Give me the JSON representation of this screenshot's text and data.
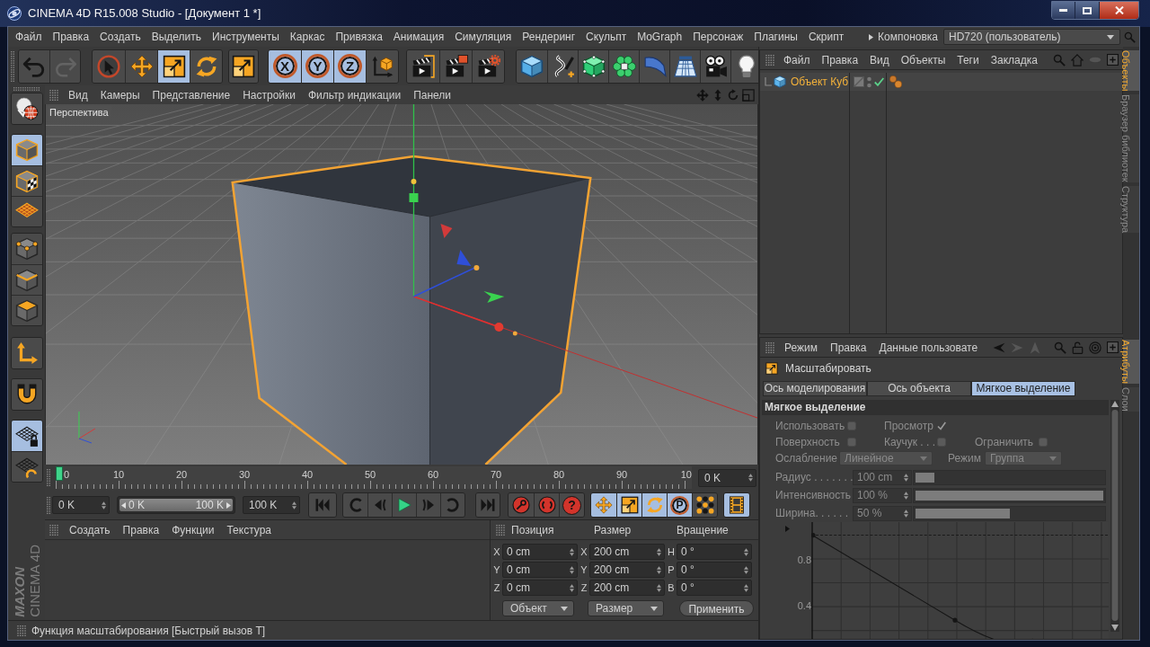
{
  "window": {
    "title": "CINEMA 4D R15.008 Studio - [Документ 1 *]"
  },
  "menu_bar": {
    "items": [
      "Файл",
      "Правка",
      "Создать",
      "Выделить",
      "Инструменты",
      "Каркас",
      "Привязка",
      "Анимация",
      "Симуляция",
      "Рендеринг",
      "Скульпт",
      "MoGraph",
      "Персонаж",
      "Плагины",
      "Скрипт"
    ],
    "layout_label": "Компоновка",
    "layout_value": "HD720 (пользователь)"
  },
  "toolbar": {
    "groups": [
      {
        "items": [
          {
            "kind": "undo",
            "selected": false,
            "disabled": false
          },
          {
            "kind": "redo",
            "selected": false,
            "disabled": true
          }
        ]
      },
      {
        "items": [
          {
            "kind": "select",
            "selected": false,
            "disabled": false
          },
          {
            "kind": "move",
            "selected": false,
            "disabled": false
          },
          {
            "kind": "scale",
            "selected": true,
            "disabled": false
          },
          {
            "kind": "rotate",
            "selected": false,
            "disabled": false
          }
        ]
      },
      {
        "items": [
          {
            "kind": "recent",
            "selected": false,
            "disabled": false
          }
        ]
      },
      {
        "items": [
          {
            "kind": "letter",
            "label": "X",
            "selected": true,
            "disabled": false
          },
          {
            "kind": "letter",
            "label": "Y",
            "selected": true,
            "disabled": false
          },
          {
            "kind": "letter",
            "label": "Z",
            "selected": true,
            "disabled": false
          },
          {
            "kind": "coords",
            "selected": false,
            "disabled": false
          }
        ]
      },
      {
        "items": [
          {
            "kind": "renderview",
            "selected": false,
            "disabled": false
          },
          {
            "kind": "renderpicture",
            "selected": false,
            "disabled": false
          },
          {
            "kind": "rendersettings",
            "selected": false,
            "disabled": false
          }
        ]
      },
      {
        "items": [
          {
            "kind": "cube",
            "selected": false,
            "disabled": false
          },
          {
            "kind": "spline",
            "selected": false,
            "disabled": false
          },
          {
            "kind": "subdivision",
            "selected": false,
            "disabled": false
          },
          {
            "kind": "array",
            "selected": false,
            "disabled": false
          },
          {
            "kind": "deformer",
            "selected": false,
            "disabled": false
          },
          {
            "kind": "floor",
            "selected": false,
            "disabled": false
          },
          {
            "kind": "camera",
            "selected": false,
            "disabled": false
          },
          {
            "kind": "light",
            "selected": false,
            "disabled": false
          }
        ]
      }
    ]
  },
  "mode_toolbar": {
    "groups": [
      {
        "items": [
          {
            "kind": "editable",
            "selected": false
          }
        ]
      },
      {
        "items": [
          {
            "kind": "model",
            "selected": true
          },
          {
            "kind": "texture",
            "selected": false
          },
          {
            "kind": "workplane",
            "selected": false
          }
        ]
      },
      {
        "items": [
          {
            "kind": "points",
            "selected": false
          },
          {
            "kind": "edges",
            "selected": false
          },
          {
            "kind": "polygons",
            "selected": false
          }
        ]
      },
      {
        "items": [
          {
            "kind": "axis",
            "selected": false
          }
        ]
      },
      {
        "items": [
          {
            "kind": "tweak",
            "selected": false
          }
        ]
      },
      {
        "items": [
          {
            "kind": "lockplane",
            "selected": true
          },
          {
            "kind": "planerotate",
            "selected": false
          }
        ]
      }
    ]
  },
  "viewport": {
    "menu": [
      "Вид",
      "Камеры",
      "Представление",
      "Настройки",
      "Фильтр индикации",
      "Панели"
    ],
    "camera_label": "Перспектива"
  },
  "timeline": {
    "ruler_labels": [
      "0",
      "10",
      "20",
      "30",
      "40",
      "50",
      "60",
      "70",
      "80",
      "90",
      "10"
    ],
    "current_frame": "0 K",
    "min_frame": "0 K",
    "range": {
      "start": "0 K",
      "end": "100 K",
      "level": 1.0
    },
    "max_frame": "100 K",
    "record_buttons": [
      {
        "kind": "record"
      },
      {
        "kind": "autokey"
      },
      {
        "kind": "letter",
        "label": "?"
      }
    ],
    "key_buttons": [
      {
        "kind": "keymove",
        "selected": true
      },
      {
        "kind": "keyscale",
        "selected": true
      },
      {
        "kind": "keyrotate",
        "selected": true
      },
      {
        "kind": "letter",
        "label": "P",
        "selected": true
      },
      {
        "kind": "keypla",
        "selected": false
      }
    ],
    "timeline_button": {
      "selected": true
    }
  },
  "material_manager": {
    "menu": [
      "Создать",
      "Правка",
      "Функции",
      "Текстура"
    ]
  },
  "logo": {
    "brand": "MAXON",
    "product": "CINEMA 4D"
  },
  "coordinates": {
    "columns": [
      "Позиция",
      "Размер",
      "Вращение"
    ],
    "rows": [
      {
        "cells": [
          {
            "axis": "X",
            "value": "0 cm"
          },
          {
            "axis": "X",
            "value": "200 cm"
          },
          {
            "axis": "H",
            "value": "0 °"
          }
        ]
      },
      {
        "cells": [
          {
            "axis": "Y",
            "value": "0 cm"
          },
          {
            "axis": "Y",
            "value": "200 cm"
          },
          {
            "axis": "P",
            "value": "0 °"
          }
        ]
      },
      {
        "cells": [
          {
            "axis": "Z",
            "value": "0 cm"
          },
          {
            "axis": "Z",
            "value": "200 cm"
          },
          {
            "axis": "B",
            "value": "0 °"
          }
        ]
      }
    ],
    "dropdowns": [
      "Объект",
      "Размер"
    ],
    "apply_button": "Применить"
  },
  "status_bar": {
    "text": "Функция масштабирования [Быстрый вызов T]"
  },
  "object_manager": {
    "menu": [
      "Файл",
      "Правка",
      "Вид",
      "Объекты",
      "Теги",
      "Закладка"
    ],
    "objects": [
      {
        "name": "Объект Куб",
        "enabled": true
      }
    ]
  },
  "object_tabs": [
    {
      "label": "Объекты",
      "selected": true
    },
    {
      "label": "Браузер библиотек",
      "selected": false
    },
    {
      "label": "Структура",
      "selected": false
    }
  ],
  "attributes": {
    "menu": [
      "Режим",
      "Правка",
      "Данные пользовате"
    ],
    "nav": [
      {
        "kind": "back",
        "disabled": false
      },
      {
        "kind": "forward",
        "disabled": true
      },
      {
        "kind": "up",
        "disabled": true
      }
    ],
    "tool_name": "Масштабировать",
    "tabs": [
      {
        "label": "Ось моделирования",
        "selected": false
      },
      {
        "label": "Ось объекта",
        "selected": false
      },
      {
        "label": "Мягкое выделение",
        "selected": true
      }
    ],
    "section": {
      "title": "Мягкое выделение",
      "rows": [
        {
          "fields": [
            {
              "kind": "checkbox",
              "label": "Использовать",
              "checked": false,
              "disabled": true
            },
            {
              "kind": "checkbox",
              "label": "Просмотр",
              "checked": true,
              "disabled": true
            }
          ]
        },
        {
          "fields": [
            {
              "kind": "checkbox",
              "label": "Поверхность",
              "checked": false,
              "disabled": true
            },
            {
              "kind": "checkbox",
              "label": "Каучук . . .",
              "checked": false,
              "disabled": true
            },
            {
              "kind": "checkbox",
              "label": "Ограничить",
              "checked": false,
              "disabled": true
            }
          ]
        },
        {
          "fields": [
            {
              "kind": "dropdown",
              "label": "Ослабление",
              "value": "Линейное",
              "disabled": true
            },
            {
              "kind": "dropdown",
              "label": "Режим",
              "value": "Группа",
              "disabled": true
            }
          ]
        }
      ],
      "sliders": [
        {
          "label": "Радиус . . . . . . .",
          "value": "100 cm",
          "level": 0.1,
          "disabled": true
        },
        {
          "label": "Интенсивность",
          "value": "100 %",
          "level": 1.0,
          "disabled": true
        },
        {
          "label": "Ширина. . . . . .",
          "value": "50 %",
          "level": 0.5,
          "disabled": true
        }
      ],
      "curve_labels": [
        "0.8",
        "0.4"
      ]
    }
  },
  "attribute_tabs": [
    {
      "label": "Атрибуты",
      "selected": true
    },
    {
      "label": "Слои",
      "selected": false
    }
  ]
}
